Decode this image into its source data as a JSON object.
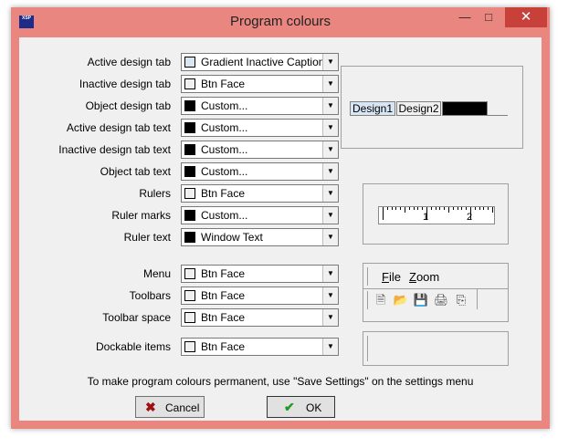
{
  "window": {
    "title": "Program colours",
    "icon_text": "XSP"
  },
  "rows": [
    {
      "label": "Active design tab",
      "value": "Gradient Inactive Caption",
      "swatch": "#d8e6f4"
    },
    {
      "label": "Inactive design tab",
      "value": "Btn Face",
      "swatch": "#f0f0f0"
    },
    {
      "label": "Object design tab",
      "value": "Custom...",
      "swatch": "#000000"
    },
    {
      "label": "Active design tab text",
      "value": "Custom...",
      "swatch": "#000000"
    },
    {
      "label": "Inactive design tab text",
      "value": "Custom...",
      "swatch": "#000000"
    },
    {
      "label": "Object tab text",
      "value": "Custom...",
      "swatch": "#000000"
    },
    {
      "label": "Rulers",
      "value": "Btn Face",
      "swatch": "#f0f0f0"
    },
    {
      "label": "Ruler marks",
      "value": "Custom...",
      "swatch": "#000000"
    },
    {
      "label": "Ruler text",
      "value": "Window Text",
      "swatch": "#000000"
    },
    {
      "label": "Menu",
      "value": "Btn Face",
      "swatch": "#f0f0f0"
    },
    {
      "label": "Toolbars",
      "value": "Btn Face",
      "swatch": "#f0f0f0"
    },
    {
      "label": "Toolbar space",
      "value": "Btn Face",
      "swatch": "#f0f0f0"
    },
    {
      "label": "Dockable items",
      "value": "Btn Face",
      "swatch": "#f0f0f0"
    }
  ],
  "preview": {
    "tabs": [
      "Design1",
      "Design2"
    ],
    "ruler_numbers": [
      "1",
      "2"
    ],
    "menu_items": [
      {
        "underlined": "F",
        "rest": "ile"
      },
      {
        "underlined": "Z",
        "rest": "oom"
      }
    ]
  },
  "note": "To make program colours permanent, use \"Save Settings\" on the settings menu",
  "buttons": {
    "cancel": "Cancel",
    "ok": "OK"
  },
  "colors": {
    "frame": "#e9867f",
    "close": "#c7403a",
    "dialog": "#f0f0f0",
    "active_tab": "#d8e6f4"
  }
}
